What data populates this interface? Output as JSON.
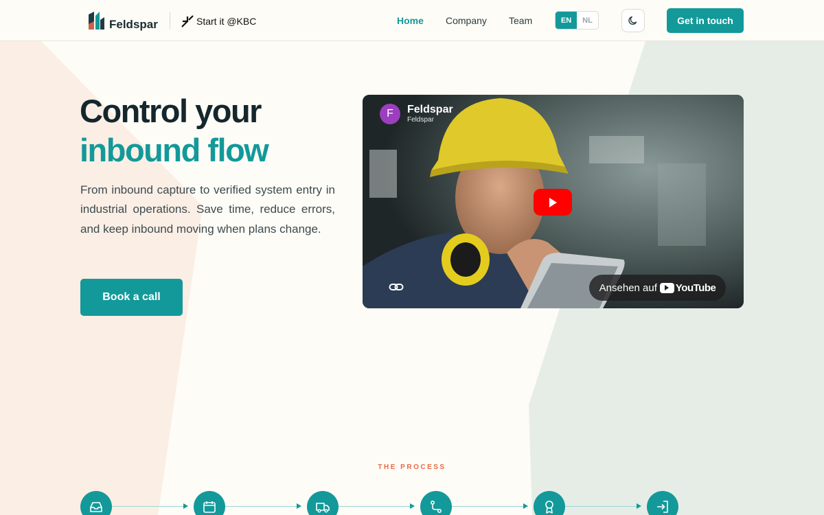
{
  "header": {
    "brand": "Feldspar",
    "partner": "Start it @KBC",
    "nav": [
      {
        "label": "Home",
        "active": true
      },
      {
        "label": "Company",
        "active": false
      },
      {
        "label": "Team",
        "active": false
      }
    ],
    "languages": [
      {
        "label": "EN",
        "active": true
      },
      {
        "label": "NL",
        "active": false
      }
    ],
    "theme_icon": "moon-icon",
    "cta_label": "Get in touch"
  },
  "hero": {
    "title_line1": "Control your",
    "title_line2": "inbound flow",
    "description": "From inbound capture to verified system entry in industrial operations. Save time, reduce errors, and keep inbound moving when plans change.",
    "cta_label": "Book a call"
  },
  "video": {
    "channel_initial": "F",
    "channel_name": "Feldspar",
    "channel_sub": "Feldspar",
    "watch_on": "Ansehen auf",
    "platform": "YouTube"
  },
  "process": {
    "label": "THE PROCESS",
    "steps": [
      {
        "icon": "inbox-icon"
      },
      {
        "icon": "calendar-icon"
      },
      {
        "icon": "truck-icon"
      },
      {
        "icon": "route-icon"
      },
      {
        "icon": "award-icon"
      },
      {
        "icon": "login-icon"
      }
    ]
  },
  "colors": {
    "accent": "#13999a",
    "text_dark": "#15262d",
    "process_label": "#e86a4a",
    "bg_peach": "#fbeee4",
    "bg_mint": "#e6ede7"
  }
}
